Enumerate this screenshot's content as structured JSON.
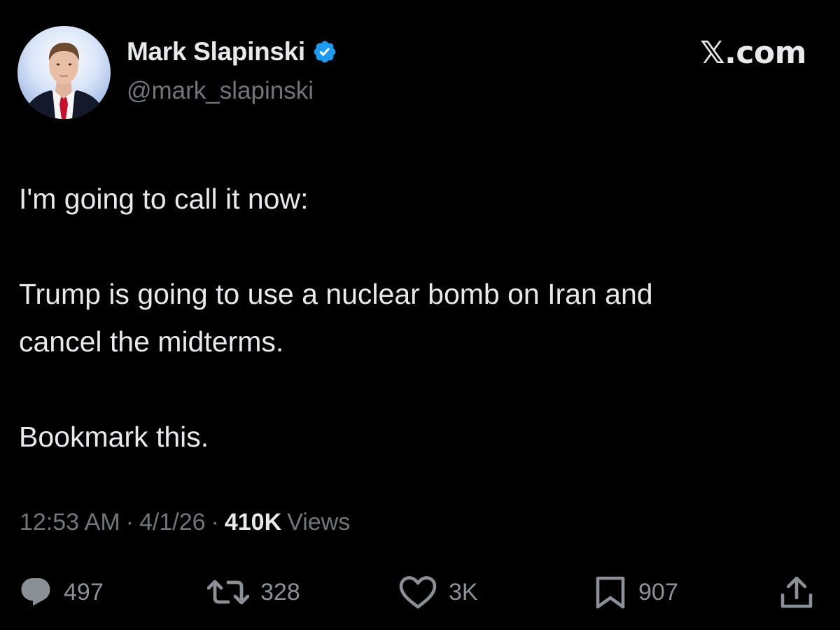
{
  "author": {
    "display_name": "Mark Slapinski",
    "handle": "@mark_slapinski",
    "verified_icon": "verified-badge-icon",
    "avatar_icon": "avatar"
  },
  "site_logo": "𝕏.com",
  "tweet": {
    "paragraphs": [
      "I'm going to call it now:",
      "Trump is going to use a nuclear bomb on Iran and\ncancel the midterms.",
      "Bookmark this."
    ]
  },
  "meta": {
    "time": "12:53 AM",
    "separator": "·",
    "date": "4/1/26",
    "views_count": "410K",
    "views_label": "Views"
  },
  "actions": {
    "reply": {
      "icon": "reply-icon",
      "count": "497"
    },
    "retweet": {
      "icon": "retweet-icon",
      "count": "328"
    },
    "like": {
      "icon": "heart-icon",
      "count": "3K"
    },
    "bookmark": {
      "icon": "bookmark-icon",
      "count": "907"
    },
    "share": {
      "icon": "share-icon"
    }
  },
  "colors": {
    "background": "#000000",
    "primary_text": "#e7e9ea",
    "secondary_text": "#71767b",
    "verified_blue": "#1d9bf0"
  }
}
